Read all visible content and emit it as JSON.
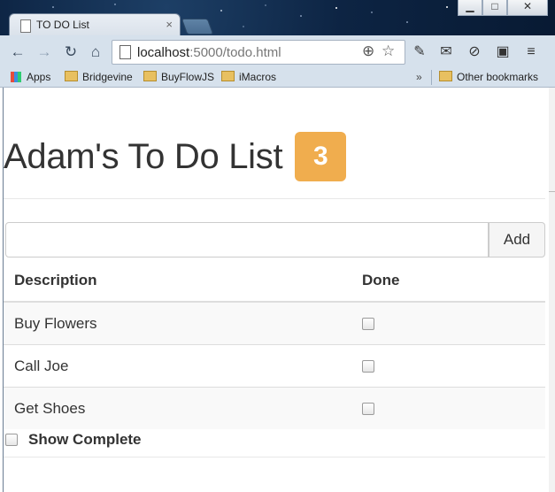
{
  "browser": {
    "tab_title": "TO DO List",
    "tab_close_glyph": "×",
    "window_buttons": [
      "▁",
      "□",
      "✕"
    ],
    "url_host": "localhost",
    "url_rest": ":5000/todo.html",
    "bookmarks": [
      {
        "label": "Apps",
        "icon": "apps-icon"
      },
      {
        "label": "Bridgevine",
        "icon": "folder-icon"
      },
      {
        "label": "BuyFlowJS",
        "icon": "folder-icon"
      },
      {
        "label": "iMacros",
        "icon": "folder-icon"
      }
    ],
    "overflow_glyph": "»",
    "other_bookmarks": "Other bookmarks"
  },
  "page": {
    "title": "Adam's To Do List",
    "incomplete_count": "3",
    "new_item": {
      "value": "",
      "placeholder": ""
    },
    "add_label": "Add",
    "columns": [
      "Description",
      "Done"
    ],
    "items": [
      {
        "description": "Buy Flowers",
        "done": false
      },
      {
        "description": "Call Joe",
        "done": false
      },
      {
        "description": "Get Shoes",
        "done": false
      }
    ],
    "show_complete_label": "Show Complete",
    "show_complete_checked": false
  },
  "colors": {
    "badge": "#f0ad4e",
    "text": "#333333",
    "striped_row": "#f9f9f9"
  }
}
